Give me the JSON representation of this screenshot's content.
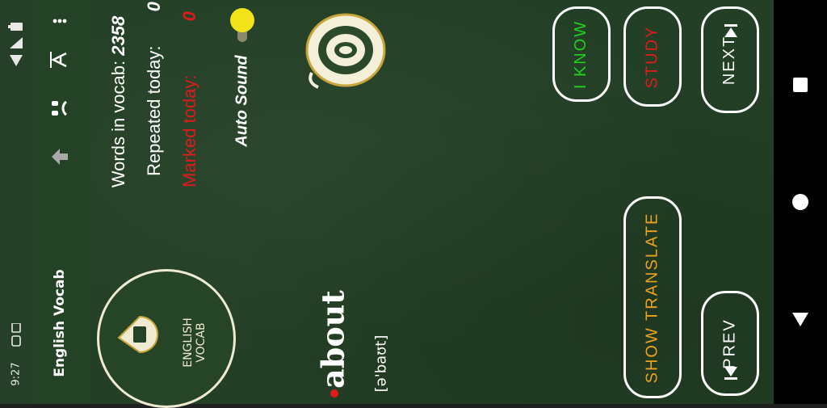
{
  "status": {
    "time": "9:27",
    "icons": [
      "sim-icon",
      "download-icon",
      "wifi-icon",
      "signal-icon",
      "battery-icon"
    ]
  },
  "toolbar": {
    "title": "English Vocab",
    "icons": [
      "back-arrow-icon",
      "headphones-icon",
      "text-size-icon",
      "more-vert-icon"
    ]
  },
  "logo": {
    "line1": "ENGLISH",
    "line2": "VOCAB"
  },
  "stats": {
    "words_label": "Words in vocab:",
    "words_value": "2358",
    "repeated_label": "Repeated today:",
    "repeated_value": "0",
    "marked_label": "Marked today:",
    "marked_value": "0"
  },
  "auto_sound": {
    "label": "Auto Sound",
    "enabled": true
  },
  "card": {
    "word": "about",
    "transcription": "[ə'baʊt]"
  },
  "buttons": {
    "i_know": "I KNOW",
    "study": "STUDY",
    "next": "NEXT",
    "show_translate": "SHOW TRANSLATE",
    "prev": "PREV"
  },
  "colors": {
    "board": "#233f25",
    "i_know": "#1ed21e",
    "study": "#e01b1b",
    "show_translate": "#f0a21c",
    "next_prev": "#ffffff",
    "marked": "#e01b1b",
    "toggle_knob": "#f2e21a"
  }
}
